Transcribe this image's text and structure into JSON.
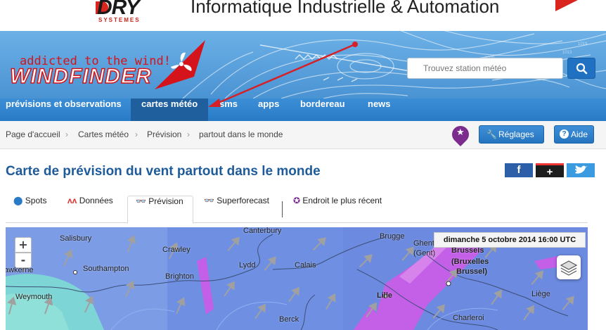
{
  "ad": {
    "brand": "DRY",
    "brand_sub": "SYSTEMES",
    "headline": "Informatique Industrielle & Automation"
  },
  "header": {
    "tagline": "addicted to the wind!",
    "logo_text": "WINDFINDER",
    "search_placeholder": "Trouvez station météo"
  },
  "nav": {
    "items": [
      {
        "label": "prévisions et observations",
        "active": false
      },
      {
        "label": "cartes météo",
        "active": true
      },
      {
        "label": "sms",
        "active": false
      },
      {
        "label": "apps",
        "active": false
      },
      {
        "label": "bordereau",
        "active": false
      },
      {
        "label": "news",
        "active": false
      }
    ]
  },
  "breadcrumb": [
    "Page d'accueil",
    "Cartes météo",
    "Prévision",
    "partout dans le monde"
  ],
  "toolbar": {
    "settings_label": "Réglages",
    "help_label": "Aide"
  },
  "page": {
    "title": "Carte de prévision du vent partout dans le monde"
  },
  "social": {
    "facebook": "f",
    "google": "+"
  },
  "tabs": [
    {
      "label": "Spots",
      "icon": "map-pin-icon"
    },
    {
      "label": "Données",
      "icon": "graph-icon"
    },
    {
      "label": "Prévision",
      "icon": "binoculars-icon",
      "active": true
    },
    {
      "label": "Superforecast",
      "icon": "binoculars-icon"
    },
    {
      "label": "Endroit le plus récent",
      "icon": "star-pin-icon"
    }
  ],
  "map": {
    "timestamp": "dimanche 5 octobre 2014 16:00 UTC",
    "zoom_in": "+",
    "zoom_out": "-",
    "cities": {
      "canterbury": "Canterbury",
      "salisbury": "Salisbury",
      "crawley": "Crawley",
      "southampton": "Southampton",
      "brighton": "Brighton",
      "lydd": "Lydd",
      "calais": "Calais",
      "bruges": "Brugge",
      "ghent": "Ghent",
      "gent": "(Gent)",
      "brussels": "Brussels",
      "bruxelles": "(Bruxelles",
      "brussel": "Brussel)",
      "lille": "Lille",
      "liege": "Liège",
      "berck": "Berck",
      "charleroi": "Charleroi",
      "weymouth": "Weymouth",
      "awkerne": "awkerne"
    }
  },
  "colors": {
    "nav_bg": "#2a7bc6",
    "nav_active": "#1f5f9e",
    "title": "#1e5b9a",
    "map_blue": "#7d9ce6",
    "map_purple": "#c65de6",
    "map_cyan": "#72c9d6",
    "accent_red": "#d4141a"
  }
}
